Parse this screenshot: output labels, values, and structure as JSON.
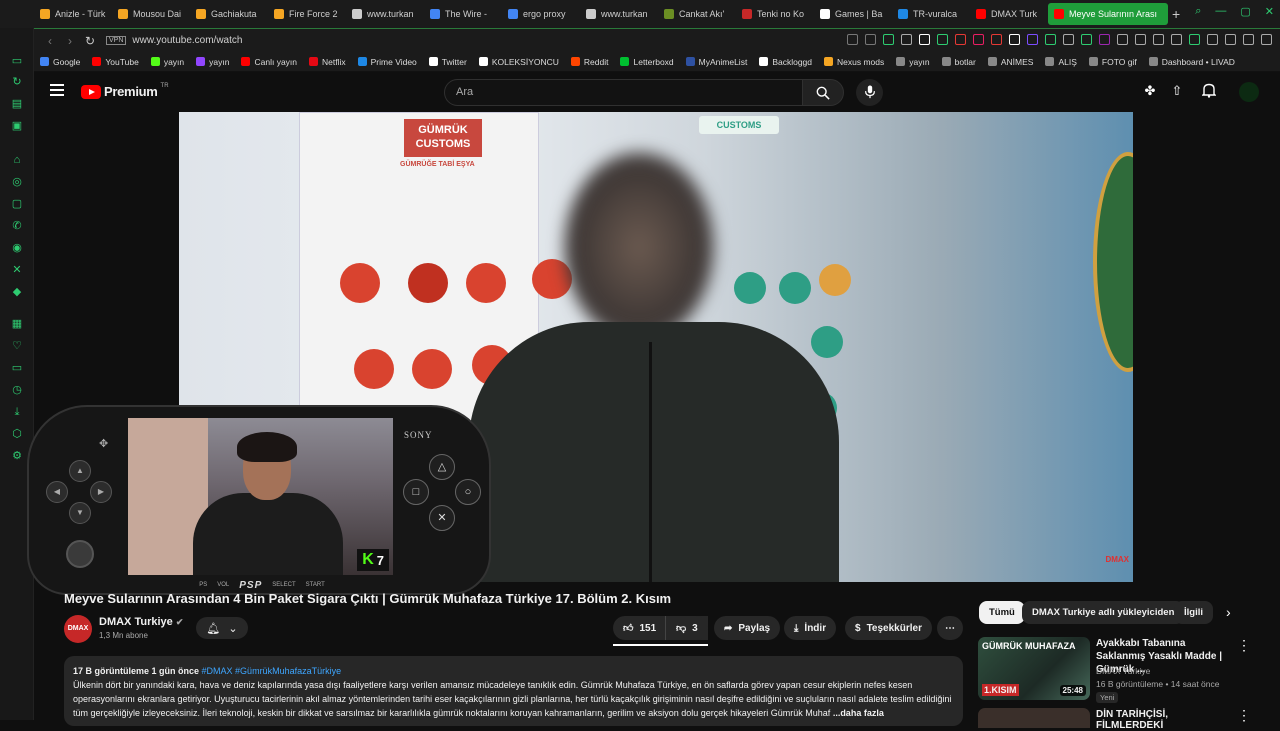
{
  "browser": {
    "tabs": [
      {
        "label": "Anizle - Türk",
        "color": "#f5a623"
      },
      {
        "label": "Mousou Dai",
        "color": "#f5a623"
      },
      {
        "label": "Gachiakuta",
        "color": "#f5a623"
      },
      {
        "label": "Fire Force 2",
        "color": "#f5a623"
      },
      {
        "label": "www.turkan",
        "color": "#cccccc"
      },
      {
        "label": "The Wire - ",
        "color": "#4285f4"
      },
      {
        "label": "ergo proxy",
        "color": "#4285f4"
      },
      {
        "label": "www.turkan",
        "color": "#cccccc"
      },
      {
        "label": "Cankat Akı'",
        "color": "#6b8e23"
      },
      {
        "label": "Tenki no Ko",
        "color": "#c62828"
      },
      {
        "label": "Games | Ba",
        "color": "#ffffff"
      },
      {
        "label": "TR-vuralca",
        "color": "#1e88e5"
      },
      {
        "label": "DMAX Turk",
        "color": "#ff0000"
      },
      {
        "label": "Meyve Sularının Arası",
        "color": "#ff0000",
        "active": true
      }
    ],
    "url": "www.youtube.com/watch",
    "vpn_label": "VPN",
    "bookmarks": [
      {
        "label": "Google",
        "color": "#4285f4"
      },
      {
        "label": "YouTube",
        "color": "#ff0000"
      },
      {
        "label": "yayın",
        "color": "#53fc18"
      },
      {
        "label": "yayın",
        "color": "#9146ff"
      },
      {
        "label": "Canlı yayın",
        "color": "#ff0000"
      },
      {
        "label": "Netflix",
        "color": "#e50914"
      },
      {
        "label": "Prime Video",
        "color": "#1e88e5"
      },
      {
        "label": "Twitter",
        "color": "#ffffff"
      },
      {
        "label": "KOLEKSİYONCU",
        "color": "#ffffff"
      },
      {
        "label": "Reddit",
        "color": "#ff4500"
      },
      {
        "label": "Letterboxd",
        "color": "#00c030"
      },
      {
        "label": "MyAnimeList",
        "color": "#2e51a2"
      },
      {
        "label": "Backloggd",
        "color": "#ffffff"
      },
      {
        "label": "Nexus mods",
        "color": "#f5a623"
      },
      {
        "label": "yayın",
        "color": "#888888"
      },
      {
        "label": "botlar",
        "color": "#888888"
      },
      {
        "label": "ANİMES",
        "color": "#888888"
      },
      {
        "label": "ALIŞ",
        "color": "#888888"
      },
      {
        "label": "FOTO gif",
        "color": "#888888"
      },
      {
        "label": "Dashboard • LIVAD",
        "color": "#888888"
      }
    ]
  },
  "youtube": {
    "logo_text": "Premium",
    "logo_region": "TR",
    "search_placeholder": "Ara"
  },
  "video": {
    "poster_text": "GÜMRÜK CUSTOMS",
    "poster_sub": "GÜMRÜĞE TABİ EŞYA",
    "watermark": "DMAX",
    "customs_sign": "CUSTOMS"
  },
  "overlay": {
    "brand": "SONY",
    "device": "PSP",
    "vol_label": "VOL",
    "select_label": "SELECT",
    "start_label": "START",
    "kick_letter": "K",
    "kick_count": "7"
  },
  "info": {
    "title": "Meyve Sularının Arasından 4 Bin Paket Sigara Çıktı | Gümrük Muhafaza Türkiye 17. Bölüm 2. Kısım",
    "channel": "DMAX Turkiye",
    "channel_avatar_text": "DMAX",
    "subs": "1,3 Mn abone",
    "likes": "151",
    "dislikes": "3",
    "share": "Paylaş",
    "download": "İndir",
    "thanks": "Teşekkürler",
    "views_date": "17 B görüntüleme  1 gün önce",
    "tags": "#DMAX #GümrükMuhafazaTürkiye",
    "description": "Ülkenin dört bir yanındaki kara, hava ve deniz kapılarında yasa dışı faaliyetlere karşı verilen amansız mücadeleye tanıklık edin. Gümrük Muhafaza Türkiye, en ön saflarda görev yapan cesur ekiplerin nefes kesen operasyonlarını ekranlara getiriyor. Uyuşturucu tacirlerinin akıl almaz yöntemlerinden tarihi eser kaçakçılarının gizli planlarına, her türlü kaçakçılık girişiminin nasıl deşifre edildiğini ve suçluların nasıl adalete teslim edildiğini tüm gerçekliğiyle izleyeceksiniz. İleri teknoloji, keskin bir dikkat ve sarsılmaz bir kararlılıkla gümrük noktalarını koruyan kahramanların, gerilim ve aksiyon dolu gerçek hikayeleri Gümrük Muhaf",
    "more": "...daha fazla"
  },
  "sidebar": {
    "chips": [
      "Tümü",
      "DMAX Turkiye adlı yükleyiciden",
      "İlgili"
    ],
    "recs": [
      {
        "title": "Ayakkabı Tabanına Saklanmış Yasaklı Madde | Gümrük ...",
        "channel": "DMAX Turkiye",
        "meta": "16 B görüntüleme  •  14 saat önce",
        "badge": "Yeni",
        "duration": "25:48",
        "thumb_top": "GÜMRÜK MUHAFAZA",
        "thumb_bottom": "1.KISIM"
      },
      {
        "title": "DİN TARİHÇİSİ, FİLMLERDEKİ"
      }
    ]
  }
}
